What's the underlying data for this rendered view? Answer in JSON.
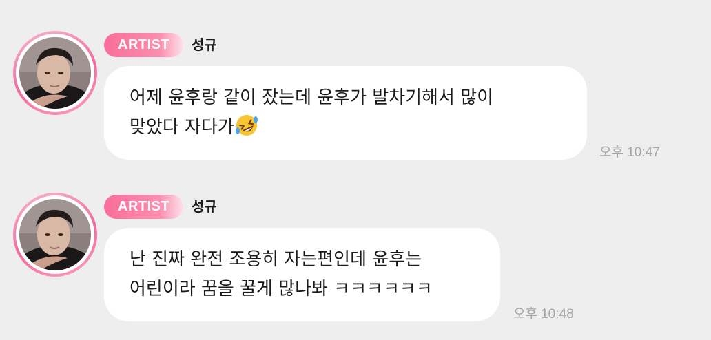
{
  "messages": [
    {
      "badge": "ARTIST",
      "sender": "성규",
      "lines": [
        "어제 윤후랑 같이 잤는데 윤후가 발차기해서 많이",
        "맞았다 자다가"
      ],
      "emoji": "rolling-on-the-floor-laughing",
      "time": "오후 10:47"
    },
    {
      "badge": "ARTIST",
      "sender": "성규",
      "lines": [
        "난 진짜 완전 조용히 자는편인데 윤후는",
        "어린이라 꿈을 꿀게 많나봐 ㅋㅋㅋㅋㅋㅋ"
      ],
      "time": "오후 10:48"
    }
  ],
  "colors": {
    "background": "#eeeeee",
    "badge_pink": "#f96d9a",
    "bubble": "#ffffff",
    "time_gray": "#a4a4a4"
  }
}
